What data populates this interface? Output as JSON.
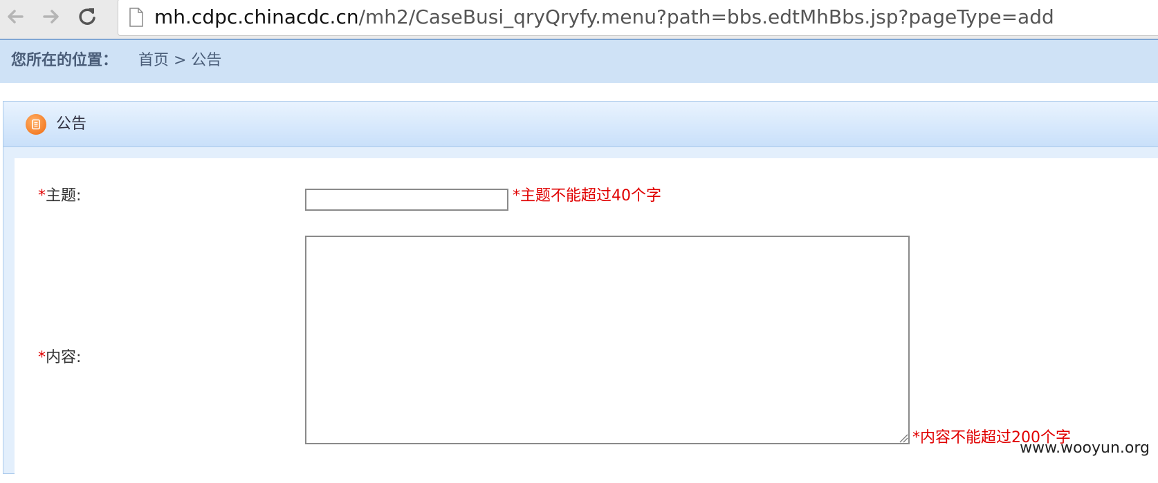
{
  "browser": {
    "url_host": "mh.cdpc.chinacdc.cn",
    "url_path": "/mh2/CaseBusi_qryQryfy.menu?path=bbs.edtMhBbs.jsp?pageType=add"
  },
  "location": {
    "label": "您所在的位置：",
    "path": "首页 > 公告"
  },
  "panel": {
    "title": "公告",
    "icon": "list-icon"
  },
  "form": {
    "required_mark": "*",
    "subject": {
      "label": "主题:",
      "value": "",
      "hint": "*主题不能超过40个字"
    },
    "content": {
      "label": "内容:",
      "value": "",
      "hint": "*内容不能超过200个字"
    }
  },
  "watermark": "www.wooyun.org",
  "colors": {
    "required": "#e00000",
    "location_bg": "#cfe2f6",
    "panel_icon": "#f06a10"
  }
}
